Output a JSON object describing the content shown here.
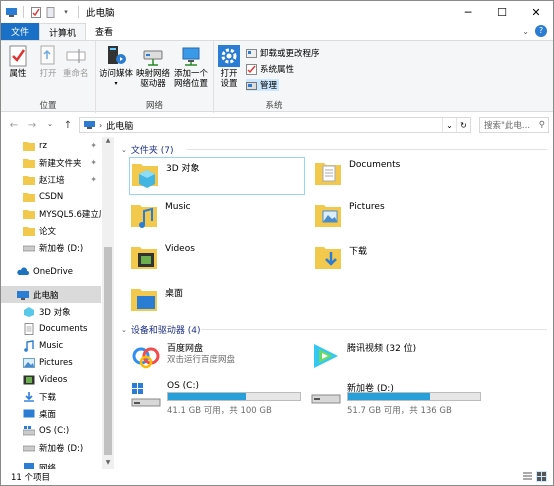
{
  "window": {
    "title": "此电脑"
  },
  "tabs": {
    "file": "文件",
    "computer": "计算机",
    "view": "查看"
  },
  "ribbon": {
    "location": {
      "label": "位置",
      "properties": "属性",
      "open": "打开",
      "rename": "重命名"
    },
    "network": {
      "label": "网络",
      "access_media": "访问媒体",
      "map_drive_1": "映射网络",
      "map_drive_2": "驱动器",
      "add_location_1": "添加一个",
      "add_location_2": "网络位置"
    },
    "system": {
      "label": "系统",
      "open_settings_1": "打开",
      "open_settings_2": "设置",
      "uninstall": "卸载或更改程序",
      "sys_props": "系统属性",
      "manage": "管理"
    }
  },
  "address": {
    "crumb": "此电脑",
    "search_placeholder": "搜索\"此电..."
  },
  "nav": {
    "items": [
      {
        "label": "rz",
        "pinned": true
      },
      {
        "label": "新建文件夹",
        "pinned": true
      },
      {
        "label": "赵江培",
        "pinned": true
      },
      {
        "label": "CSDN",
        "pinned": false
      },
      {
        "label": "MYSQL5.6建立库",
        "pinned": false
      },
      {
        "label": "论文",
        "pinned": false
      },
      {
        "label": "新加卷 (D:)",
        "pinned": false
      },
      {
        "label": "OneDrive",
        "pinned": false
      },
      {
        "label": "此电脑",
        "pinned": false
      },
      {
        "label": "3D 对象",
        "pinned": false
      },
      {
        "label": "Documents",
        "pinned": false
      },
      {
        "label": "Music",
        "pinned": false
      },
      {
        "label": "Pictures",
        "pinned": false
      },
      {
        "label": "Videos",
        "pinned": false
      },
      {
        "label": "下载",
        "pinned": false
      },
      {
        "label": "桌面",
        "pinned": false
      },
      {
        "label": "OS (C:)",
        "pinned": false
      },
      {
        "label": "新加卷 (D:)",
        "pinned": false
      },
      {
        "label": "网络",
        "pinned": false
      }
    ]
  },
  "folders": {
    "header": "文件夹 (7)",
    "items": [
      {
        "name": "3D 对象"
      },
      {
        "name": "Documents"
      },
      {
        "name": "Music"
      },
      {
        "name": "Pictures"
      },
      {
        "name": "Videos"
      },
      {
        "name": "下载"
      },
      {
        "name": "桌面"
      }
    ]
  },
  "devices": {
    "header": "设备和驱动器 (4)",
    "baidu": {
      "name": "百度网盘",
      "sub": "双击运行百度网盘"
    },
    "tencent": {
      "name": "腾讯视频 (32 位)"
    },
    "c": {
      "name": "OS (C:)",
      "size": "41.1 GB 可用，共 100 GB",
      "used_fraction": 0.589
    },
    "d": {
      "name": "新加卷 (D:)",
      "size": "51.7 GB 可用，共 136 GB",
      "used_fraction": 0.62
    }
  },
  "status": {
    "count": "11 个项目"
  },
  "colors": {
    "accent": "#1a6fc7",
    "bar_fill": "#26a0da",
    "folder": "#f2c94c"
  }
}
